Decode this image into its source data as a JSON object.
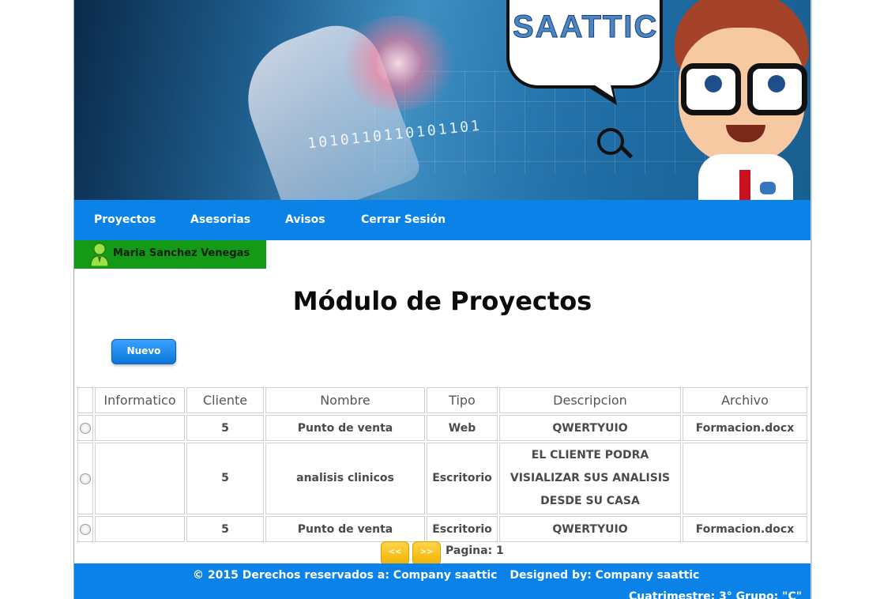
{
  "banner": {
    "brand_text": "SAATTIC",
    "binary_text": "1010110110101101"
  },
  "nav": {
    "items": [
      {
        "label": "Proyectos"
      },
      {
        "label": "Asesorias"
      },
      {
        "label": "Avisos"
      },
      {
        "label": "Cerrar Sesión"
      }
    ],
    "color": "#0a82e8"
  },
  "user": {
    "name": "Maria Sanchez Venegas",
    "icon": "user-icon",
    "badge_color": "#149a16"
  },
  "main": {
    "title": "Módulo de Proyectos",
    "new_button_label": "Nuevo"
  },
  "table": {
    "headers": [
      "",
      "Informatico",
      "Cliente",
      "Nombre",
      "Tipo",
      "Descripcion",
      "Archivo"
    ],
    "rows": [
      {
        "informatico": "",
        "cliente": "5",
        "nombre": "Punto de venta",
        "tipo": "Web",
        "descripcion": "QWERTYUIO",
        "archivo": "Formacion.docx"
      },
      {
        "informatico": "",
        "cliente": "5",
        "nombre": "analisis clinicos",
        "tipo": "Escritorio",
        "descripcion": "EL CLIENTE PODRA VISIALIZAR SUS ANALISIS DESDE SU CASA",
        "archivo": ""
      },
      {
        "informatico": "",
        "cliente": "5",
        "nombre": "Punto de venta",
        "tipo": "Escritorio",
        "descripcion": "QWERTYUIO",
        "archivo": "Formacion.docx"
      }
    ]
  },
  "pager": {
    "prev_label": "<<",
    "next_label": ">>",
    "page_label": "Pagina: 1"
  },
  "footer": {
    "rights": "© 2015 Derechos reservados a: Company saattic",
    "designed": "Designed by: Company saattic",
    "sub": "Cuatrimestre: 3° Grupo: \"C\""
  }
}
